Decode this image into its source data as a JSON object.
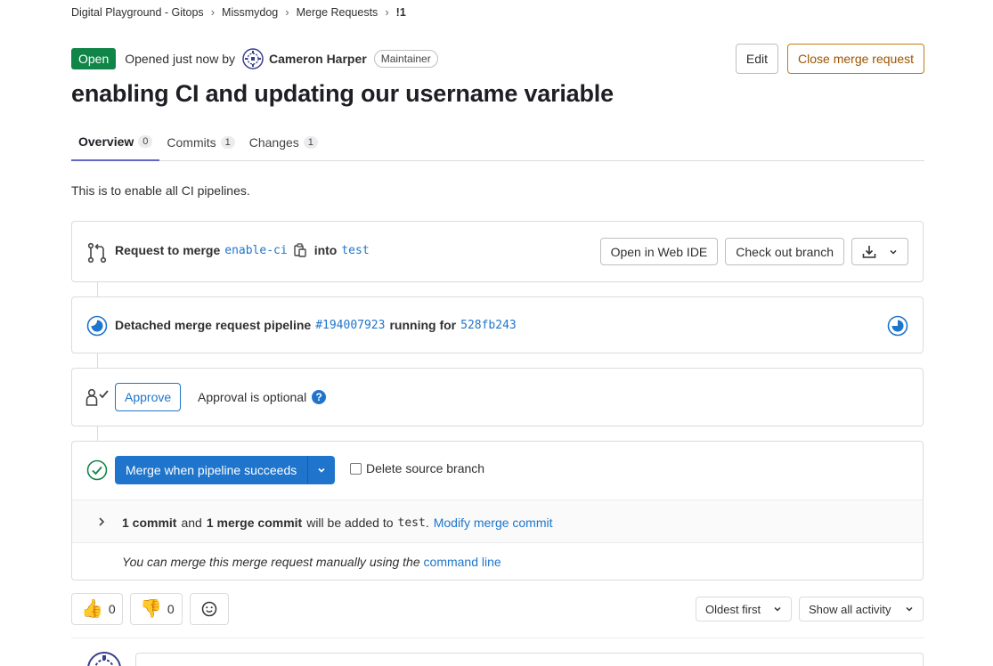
{
  "breadcrumb": {
    "items": [
      "Digital Playground - Gitops",
      "Missmydog",
      "Merge Requests",
      "!1"
    ]
  },
  "header": {
    "status": "Open",
    "opened_text": "Opened just now by",
    "author": "Cameron Harper",
    "role": "Maintainer",
    "edit_label": "Edit",
    "close_label": "Close merge request",
    "title": "enabling CI and updating our username variable"
  },
  "tabs": [
    {
      "label": "Overview",
      "count": "0"
    },
    {
      "label": "Commits",
      "count": "1"
    },
    {
      "label": "Changes",
      "count": "1"
    }
  ],
  "description": "This is to enable all CI pipelines.",
  "merge_request": {
    "prefix": "Request to merge",
    "source_branch": "enable-ci",
    "into": "into",
    "target_branch": "test",
    "web_ide_label": "Open in Web IDE",
    "checkout_label": "Check out branch"
  },
  "pipeline": {
    "prefix": "Detached merge request pipeline",
    "id": "#194007923",
    "running_for": "running for",
    "sha": "528fb243"
  },
  "approval": {
    "approve_label": "Approve",
    "optional_text": "Approval is optional"
  },
  "merge": {
    "button_label": "Merge when pipeline succeeds",
    "delete_source_label": "Delete source branch",
    "commit_count": "1 commit",
    "and": "and",
    "merge_commit": "1 merge commit",
    "will_be_added": "will be added to",
    "target": "test",
    "period": ".",
    "modify_label": "Modify merge commit",
    "manual_prefix": "You can merge this merge request manually using the",
    "command_line": "command line"
  },
  "reactions": {
    "thumbs_up_count": "0",
    "thumbs_down_count": "0"
  },
  "activity": {
    "sort_label": "Oldest first",
    "filter_label": "Show all activity"
  },
  "colors": {
    "status_green": "#108548",
    "link_blue": "#1f75cb",
    "warning_orange": "#9e5400",
    "tab_underline": "#6666c4"
  }
}
